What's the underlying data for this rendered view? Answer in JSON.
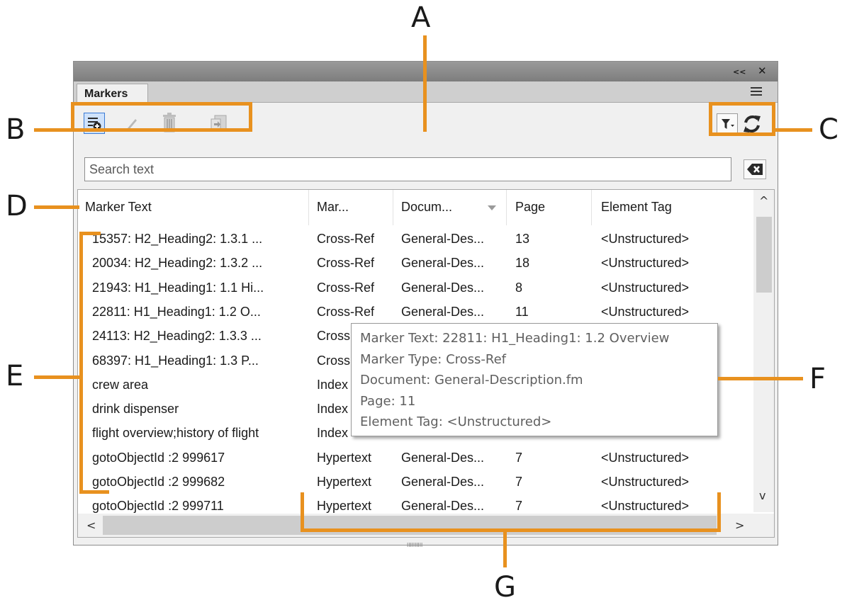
{
  "panel": {
    "title_controls": {
      "collapse": "<<",
      "close": "✕"
    },
    "tab": "Markers",
    "toolbar": {
      "buttons": [
        {
          "icon": "new-marker-icon",
          "name": "new-marker"
        },
        {
          "icon": "pencil-icon",
          "name": "edit-marker"
        },
        {
          "icon": "trash-icon",
          "name": "delete-marker"
        },
        {
          "icon": "import-icon",
          "name": "insert-marker"
        }
      ],
      "right_buttons": [
        {
          "icon": "filter-icon",
          "name": "filter"
        },
        {
          "icon": "refresh-icon",
          "name": "refresh"
        }
      ]
    },
    "search": {
      "placeholder": "Search text",
      "clear_icon": "backspace-icon"
    },
    "columns": [
      "Marker Text",
      "Mar...",
      "Docum...",
      "Page",
      "Element Tag"
    ],
    "rows": [
      [
        "15357: H2_Heading2: 1.3.1 ...",
        "Cross-Ref",
        "General-Des...",
        "13",
        "<Unstructured>"
      ],
      [
        "20034: H2_Heading2: 1.3.2 ...",
        "Cross-Ref",
        "General-Des...",
        "18",
        "<Unstructured>"
      ],
      [
        "21943: H1_Heading1: 1.1 Hi...",
        "Cross-Ref",
        "General-Des...",
        "8",
        "<Unstructured>"
      ],
      [
        "22811: H1_Heading1: 1.2 O...",
        "Cross-Ref",
        "General-Des...",
        "11",
        "<Unstructured>"
      ],
      [
        "24113: H2_Heading2: 1.3.3 ...",
        "Cross",
        "",
        "",
        ""
      ],
      [
        "68397: H1_Heading1: 1.3 P...",
        "Cross",
        "",
        "",
        ""
      ],
      [
        "crew area",
        "Index",
        "",
        "",
        ""
      ],
      [
        "drink dispenser",
        "Index",
        "",
        "",
        ""
      ],
      [
        "flight overview;history of flight",
        "Index",
        "",
        "",
        ""
      ],
      [
        "gotoObjectId :2 999617",
        "Hypertext",
        "General-Des...",
        "7",
        "<Unstructured>"
      ],
      [
        "gotoObjectId :2 999682",
        "Hypertext",
        "General-Des...",
        "7",
        "<Unstructured>"
      ],
      [
        "gotoObjectId :2 999711",
        "Hypertext",
        "General-Des...",
        "7",
        "<Unstructured>"
      ]
    ],
    "scroll": {
      "up": "^",
      "down": "v",
      "left": "<",
      "right": ">",
      "grip": "IIIIIIIIII"
    }
  },
  "tooltip": {
    "lines": [
      "Marker Text: 22811: H1_Heading1: 1.2 Overview",
      "Marker Type: Cross-Ref",
      "Document: General-Description.fm",
      "Page: 11",
      "Element Tag: <Unstructured>"
    ]
  },
  "callouts": {
    "A": "A",
    "B": "B",
    "C": "C",
    "D": "D",
    "E": "E",
    "F": "F",
    "G": "G"
  },
  "colors": {
    "callout": "#e8911f",
    "panel_bg": "#f0f0f0",
    "title_bar": "#8a8a8a"
  }
}
